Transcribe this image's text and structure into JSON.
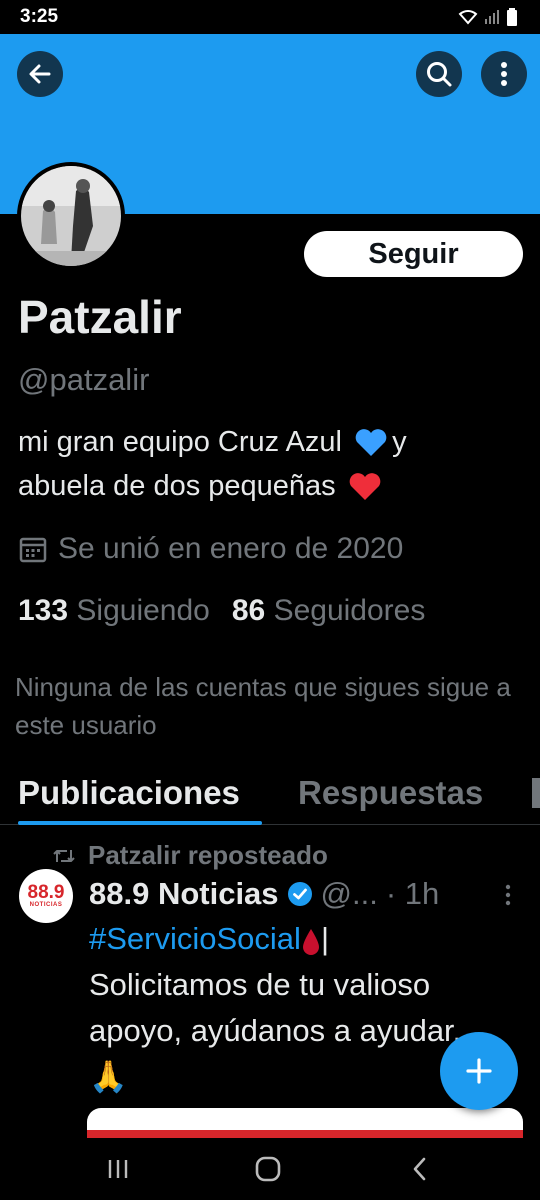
{
  "status": {
    "time": "3:25"
  },
  "profile": {
    "name": "Patzalir",
    "handle": "@patzalir",
    "follow_label": "Seguir",
    "bio_line1": "mi gran equipo Cruz Azul",
    "bio_line1_end": "y",
    "bio_line2": "abuela de dos pequeñas",
    "joined": "Se unió en enero de 2020",
    "following_count": "133",
    "following_label": "Siguiendo",
    "followers_count": "86",
    "followers_label": "Seguidores",
    "not_followed_text": "Ninguna de las cuentas que sigues sigue a este usuario"
  },
  "tabs": [
    {
      "label": "Publicaciones",
      "active": true
    },
    {
      "label": "Respuestas",
      "active": false
    }
  ],
  "post": {
    "repost_label": "Patzalir reposteado",
    "author": "88.9 Noticias",
    "author_handle": "@...",
    "time": "· 1h",
    "avatar_text": "88.9",
    "avatar_subtext": "NOTICIAS",
    "hashtag": "#ServicioSocial",
    "text_after_hashtag": "|",
    "body": "Solicitamos de tu valioso apoyo, ayúdanos a ayudar.",
    "emoji_end": "🙏"
  },
  "colors": {
    "accent": "#1d9bf0",
    "background": "#000000",
    "muted": "#71767b"
  },
  "icons": [
    "back-arrow-icon",
    "search-icon",
    "more-vertical-icon",
    "calendar-icon",
    "repost-icon",
    "verified-icon",
    "compose-plus-icon"
  ]
}
